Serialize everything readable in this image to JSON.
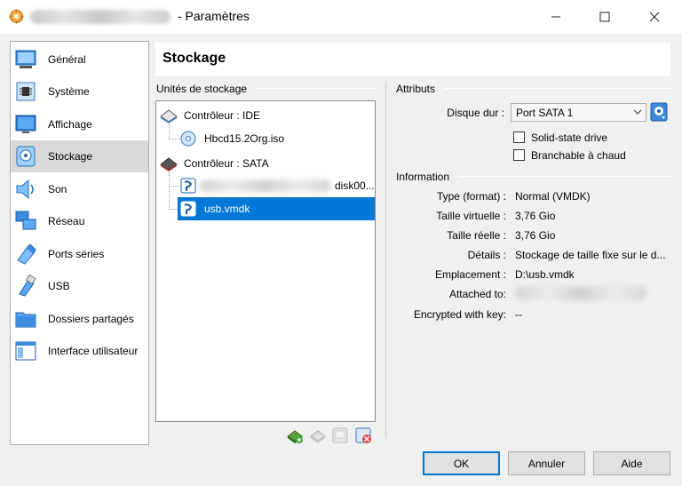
{
  "window": {
    "title": "- Paramètres",
    "icons": {
      "app": "virtualbox-gear-icon",
      "minimize": "minimize-icon",
      "maximize": "maximize-icon",
      "close": "close-icon"
    }
  },
  "sidebar": {
    "items": [
      {
        "label": "Général",
        "icon": "general-icon"
      },
      {
        "label": "Système",
        "icon": "system-chip-icon"
      },
      {
        "label": "Affichage",
        "icon": "display-monitor-icon"
      },
      {
        "label": "Stockage",
        "icon": "storage-disk-icon",
        "selected": true
      },
      {
        "label": "Son",
        "icon": "speaker-icon"
      },
      {
        "label": "Réseau",
        "icon": "network-icon"
      },
      {
        "label": "Ports séries",
        "icon": "serial-port-icon"
      },
      {
        "label": "USB",
        "icon": "usb-icon"
      },
      {
        "label": "Dossiers partagés",
        "icon": "shared-folder-icon"
      },
      {
        "label": "Interface utilisateur",
        "icon": "user-interface-icon"
      }
    ]
  },
  "header": {
    "title": "Stockage"
  },
  "storage": {
    "group_title": "Unités de stockage",
    "controllers": [
      {
        "label": "Contrôleur : IDE",
        "devices": [
          {
            "label": "Hbcd15.2Org.iso",
            "icon": "optical-disc-icon"
          }
        ]
      },
      {
        "label": "Contrôleur : SATA",
        "devices": [
          {
            "label": "disk00...",
            "icon": "hard-disk-icon"
          },
          {
            "label": "usb.vmdk",
            "icon": "hard-disk-icon",
            "selected": true
          }
        ]
      }
    ],
    "toolbar": [
      "add-controller-icon",
      "remove-controller-icon",
      "add-attachment-icon",
      "remove-attachment-icon"
    ]
  },
  "attributes": {
    "group_title": "Attributs",
    "disk_label": "Disque dur :",
    "disk_value": "Port SATA 1",
    "ssd_label": "Solid-state drive",
    "hotplug_label": "Branchable à chaud"
  },
  "information": {
    "group_title": "Information",
    "rows": [
      {
        "label": "Type (format) :",
        "value": "Normal (VMDK)"
      },
      {
        "label": "Taille virtuelle :",
        "value": "3,76 Gio"
      },
      {
        "label": "Taille réelle :",
        "value": "3,76 Gio"
      },
      {
        "label": "Détails :",
        "value": "Stockage de taille fixe sur le d..."
      },
      {
        "label": "Emplacement :",
        "value": "D:\\usb.vmdk"
      },
      {
        "label": "Attached to:",
        "value": ""
      },
      {
        "label": "Encrypted with key:",
        "value": "--"
      }
    ]
  },
  "buttons": {
    "ok": "OK",
    "cancel": "Annuler",
    "help": "Aide"
  }
}
